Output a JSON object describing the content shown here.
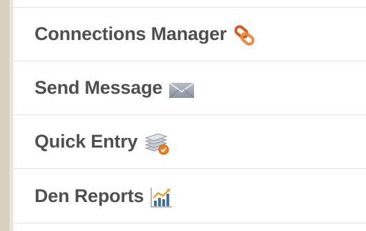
{
  "menu": {
    "items": [
      {
        "label": "Connections Manager",
        "icon": "chain-link-icon"
      },
      {
        "label": "Send Message",
        "icon": "envelope-icon"
      },
      {
        "label": "Quick Entry",
        "icon": "stack-checkmark-icon"
      },
      {
        "label": "Den Reports",
        "icon": "chart-icon"
      }
    ]
  },
  "colors": {
    "text": "#4f4f4f",
    "divider": "#e3e3e3",
    "left_bar": "#d9d0bf",
    "link_orange": "#e8672a",
    "envelope_gray": "#9aa3ac",
    "badge_orange": "#f07d1a",
    "chart_blue": "#3a6fb2",
    "chart_orange": "#f39b1f"
  }
}
